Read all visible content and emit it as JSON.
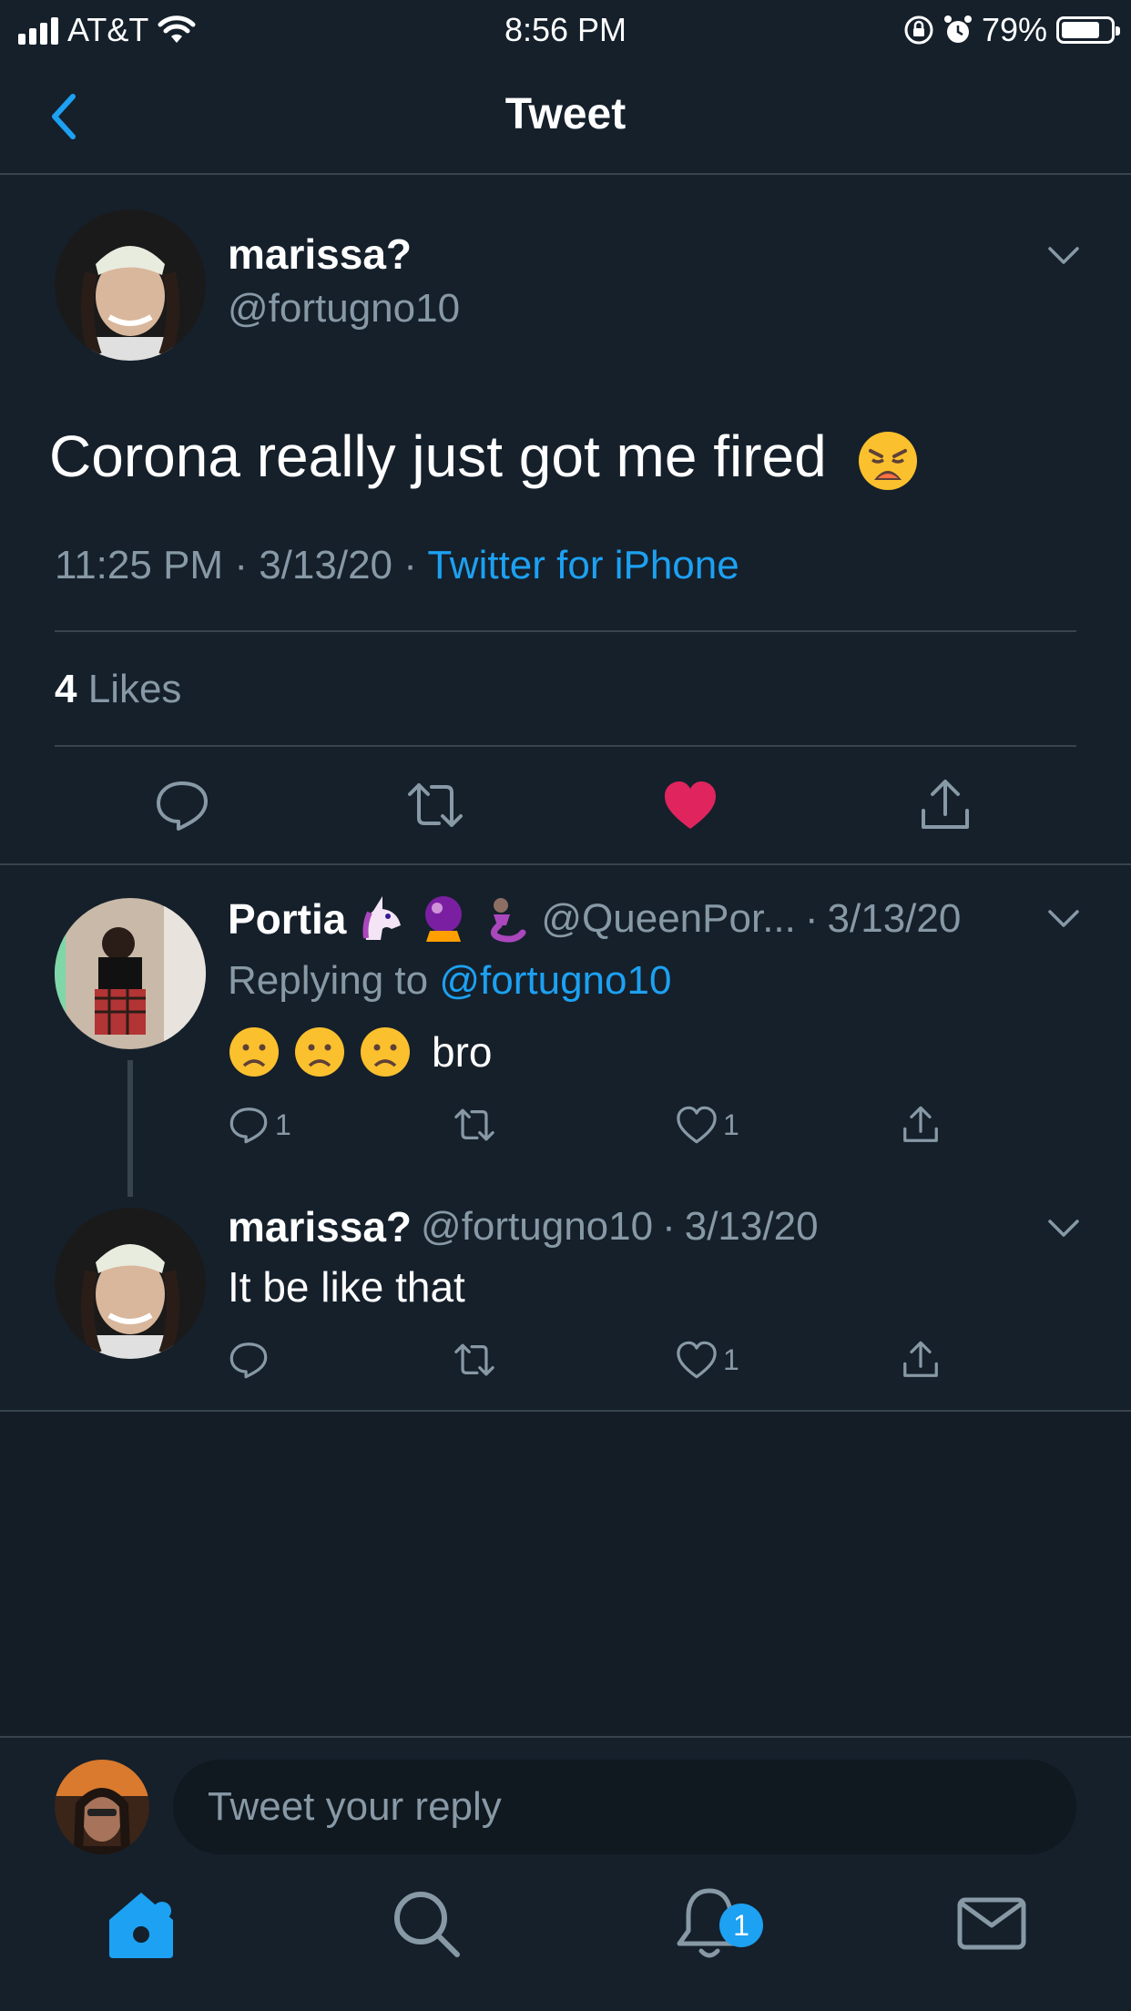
{
  "status_bar": {
    "carrier": "AT&T",
    "time": "8:56 PM",
    "battery": "79%",
    "battery_level": 0.79
  },
  "nav": {
    "title": "Tweet"
  },
  "main_tweet": {
    "name": "marissa?",
    "handle": "@fortugno10",
    "text": "Corona really just got me fired",
    "time": "11:25 PM",
    "sep": "·",
    "date": "3/13/20",
    "source": "Twitter for iPhone",
    "likes_count": "4",
    "likes_label": "Likes"
  },
  "replies": [
    {
      "name": "Portia",
      "handle": "@QueenPor...",
      "date": "3/13/20",
      "dot": "·",
      "replying_prefix": "Replying to",
      "replying_to": "@fortugno10",
      "text": "bro",
      "reply_count": "1",
      "like_count": "1"
    },
    {
      "name": "marissa?",
      "handle": "@fortugno10",
      "date": "3/13/20",
      "dot": "·",
      "text": "It be like that",
      "like_count": "1"
    }
  ],
  "reply_bar": {
    "placeholder": "Tweet your reply"
  },
  "tabbar": {
    "notifications_badge": "1"
  },
  "colors": {
    "accent": "#1da1f2",
    "like": "#e0245e",
    "background": "#15202b",
    "muted": "#8899a6"
  }
}
